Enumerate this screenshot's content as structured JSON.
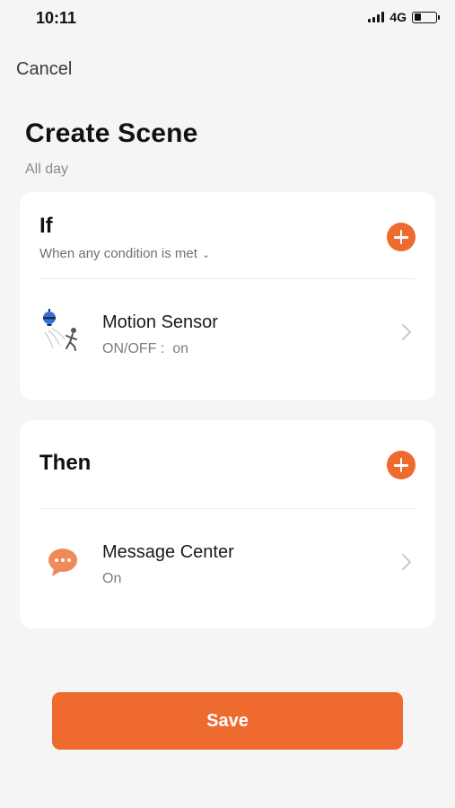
{
  "status_bar": {
    "time": "10:11",
    "network": "4G",
    "battery_level": 0.3
  },
  "nav": {
    "cancel_label": "Cancel"
  },
  "page": {
    "title": "Create Scene",
    "subtitle": "All day"
  },
  "if_section": {
    "heading": "If",
    "condition_label": "When any condition is met",
    "items": [
      {
        "title": "Motion Sensor",
        "detail": "ON/OFF :  on",
        "icon": "motion-sensor-icon"
      }
    ]
  },
  "then_section": {
    "heading": "Then",
    "items": [
      {
        "title": "Message Center",
        "detail": "On",
        "icon": "message-bubble-icon"
      }
    ]
  },
  "footer": {
    "save_label": "Save"
  },
  "colors": {
    "accent": "#ee6a2f",
    "background": "#f5f5f6",
    "card": "#ffffff",
    "sensor_blue": "#3b6fd8"
  }
}
